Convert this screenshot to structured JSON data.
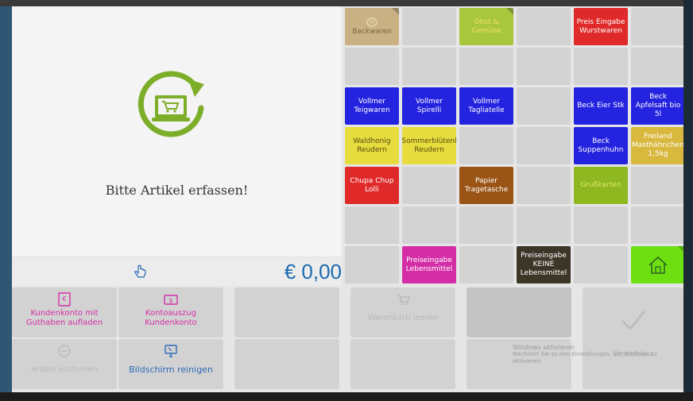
{
  "left_panel": {
    "prompt": "Bitte Artikel erfassen!",
    "logo_icon": "cart-on-laptop-icon"
  },
  "amount_bar": {
    "hand_icon": "hand-pointer-icon",
    "total": "€ 0,00"
  },
  "grid": {
    "cells": [
      {
        "label": "Backwaren",
        "color": "#c9b184",
        "text_color": "#7a6240",
        "icon": "bread-icon"
      },
      {
        "label": "Obst &\nGemüse",
        "color": "#a8c73c",
        "text_color": "#f1e06a"
      },
      {
        "label": "Preis Eingabe\nWurstwaren",
        "color": "#e02a2a",
        "text_color": "#ffffff"
      },
      {
        "label": "Vollmer\nTeigwaren",
        "color": "#2424e0",
        "text_color": "#ffffff"
      },
      {
        "label": "Vollmer Spirelli",
        "color": "#2424e0",
        "text_color": "#ffffff"
      },
      {
        "label": "Vollmer\nTagliatelle",
        "color": "#2424e0",
        "text_color": "#ffffff"
      },
      {
        "label": "Beck Eier Stk",
        "color": "#2424e0",
        "text_color": "#ffffff"
      },
      {
        "label": "Beck\nApfelsaft bio\n5l",
        "color": "#2424e0",
        "text_color": "#ffffff"
      },
      {
        "label": "Waldhonig\nReudern",
        "color": "#e6dc3e",
        "text_color": "#5a4a10"
      },
      {
        "label": "Sommerblütenl\nReudern",
        "color": "#e6dc3e",
        "text_color": "#5a4a10"
      },
      {
        "label": "Beck\nSuppenhuhn",
        "color": "#2424e0",
        "text_color": "#ffffff"
      },
      {
        "label": "Freiland\nMasthähnchen\n1,5kg",
        "color": "#d9b83e",
        "text_color": "#ffffff"
      },
      {
        "label": "Chupa Chup\nLolli",
        "color": "#e02a2a",
        "text_color": "#ffffff"
      },
      {
        "label": "Papier\nTragetasche",
        "color": "#9a5416",
        "text_color": "#ffffff"
      },
      {
        "label": "Grußkarten",
        "color": "#8fb820",
        "text_color": "#d9e86a"
      },
      {
        "label": "Preiseingabe\nLebensmittel",
        "color": "#d42ea6",
        "text_color": "#ffffff"
      },
      {
        "label": "Preiseingabe\nKEINE\nLebensmittel",
        "color": "#3c3628",
        "text_color": "#ffffff"
      },
      {
        "label": "",
        "color": "#6ee012",
        "text_color": "#2f6b1f",
        "icon": "home-icon"
      }
    ]
  },
  "bottom": {
    "btn1": {
      "label": "Kundenkonto mit\nGuthaben aufladen",
      "icon": "account-topup-icon"
    },
    "btn2": {
      "label": "Kontoauszug\nKundenkonto",
      "icon": "statement-icon"
    },
    "btn3": {
      "label": "Warenkorb leeren",
      "icon": "clear-basket-icon"
    },
    "btn4": {
      "label": "Bezahlen",
      "icon": "checkmark-icon"
    },
    "btn5": {
      "label": "Artikel entfernen",
      "icon": "remove-item-icon"
    },
    "btn6": {
      "label": "Bildschirm reinigen",
      "icon": "clean-screen-icon"
    },
    "watermark_title": "Windows aktivieren",
    "watermark_text": "Wechseln Sie zu den Einstellungen, um Windows zu aktivieren."
  }
}
